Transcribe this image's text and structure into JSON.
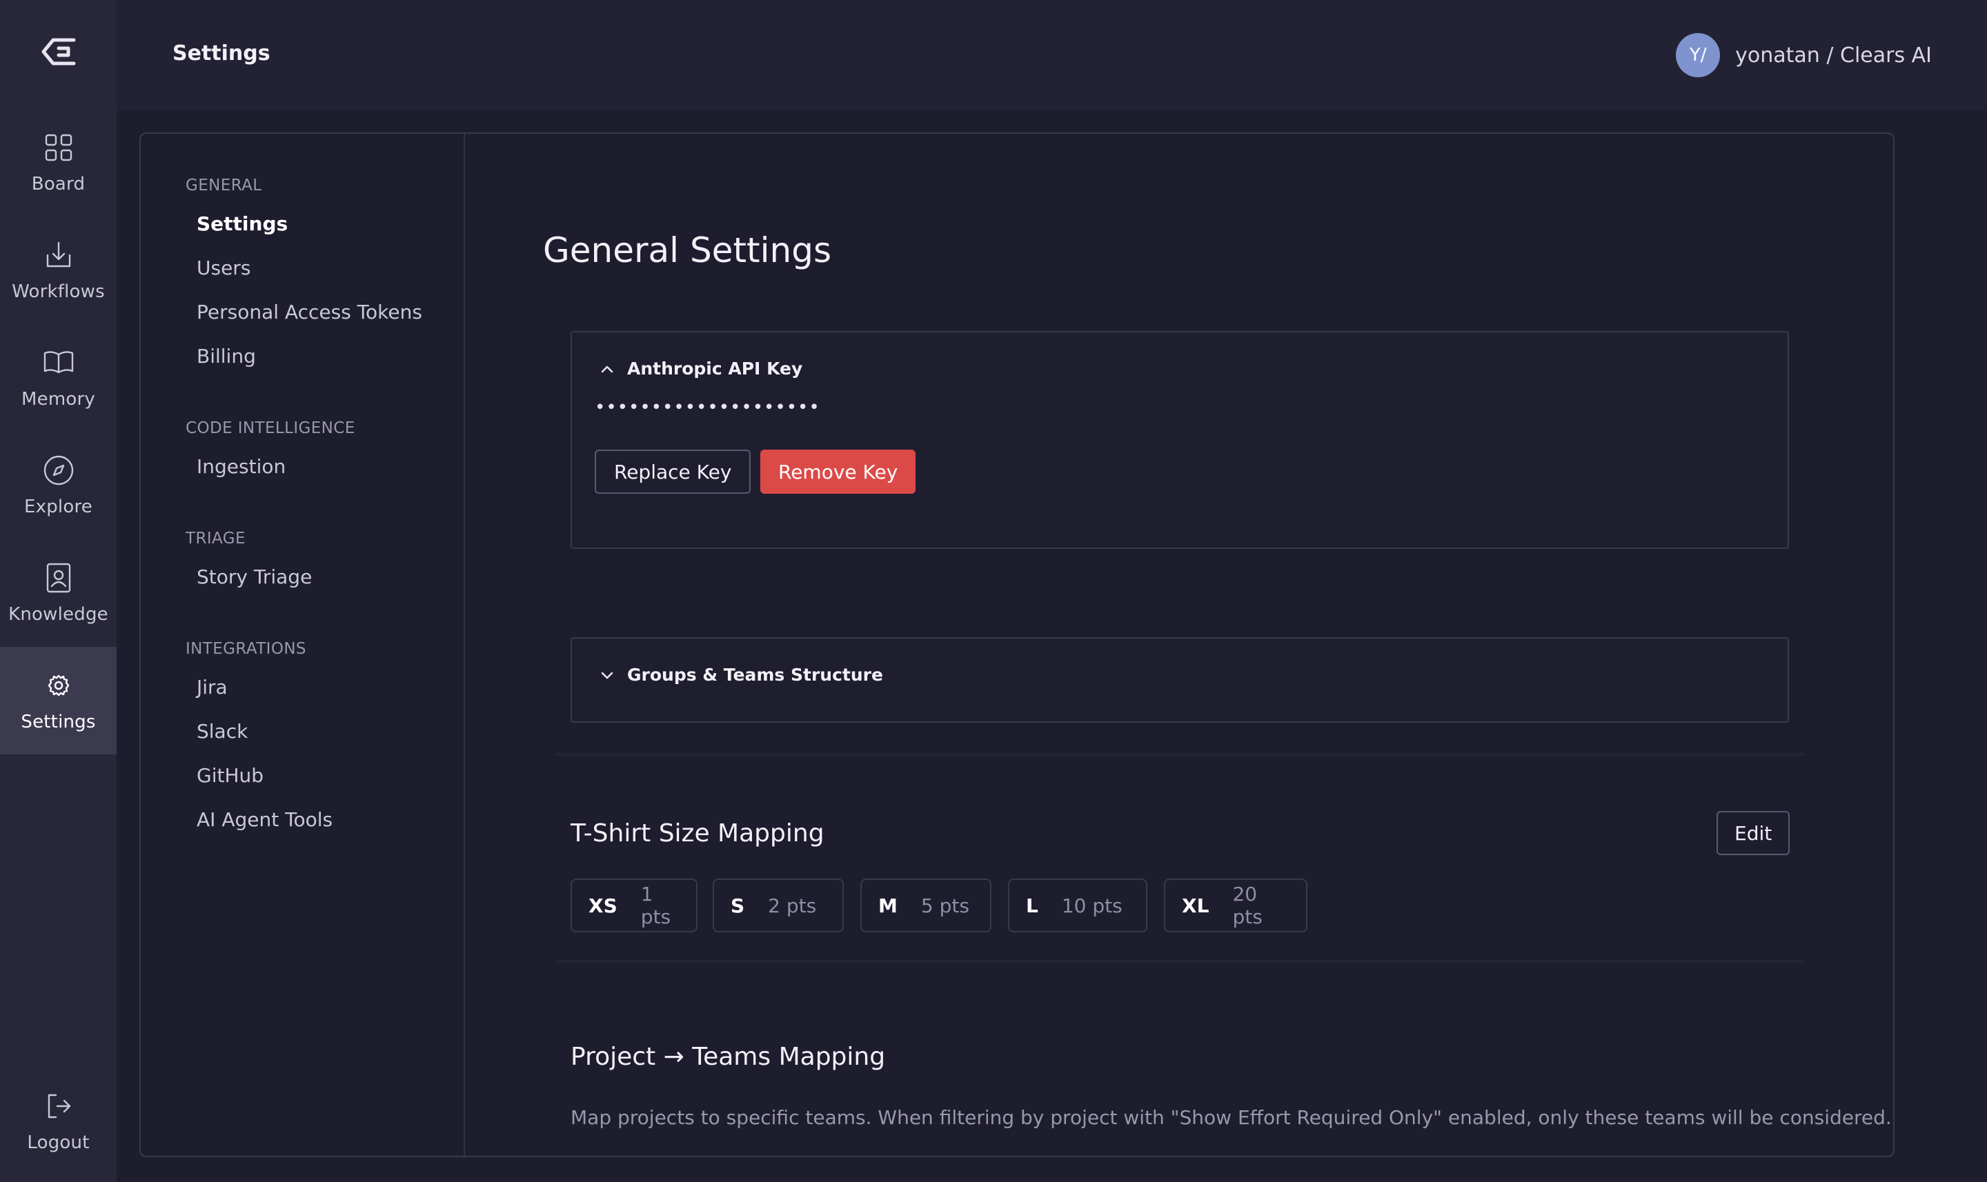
{
  "rail": {
    "items": [
      {
        "label": "Board",
        "icon": "grid-icon"
      },
      {
        "label": "Workflows",
        "icon": "workflow-icon"
      },
      {
        "label": "Memory",
        "icon": "book-icon"
      },
      {
        "label": "Explore",
        "icon": "compass-icon"
      },
      {
        "label": "Knowledge",
        "icon": "contact-book-icon"
      },
      {
        "label": "Settings",
        "icon": "gear-icon",
        "active": true
      }
    ],
    "logout": {
      "label": "Logout",
      "icon": "logout-icon"
    }
  },
  "header": {
    "title": "Settings",
    "avatar_initials": "Y/",
    "user_label": "yonatan / Clears AI"
  },
  "nav": {
    "sections": [
      {
        "title": "GENERAL",
        "items": [
          "Settings",
          "Users",
          "Personal Access Tokens",
          "Billing"
        ]
      },
      {
        "title": "CODE INTELLIGENCE",
        "items": [
          "Ingestion"
        ]
      },
      {
        "title": "TRIAGE",
        "items": [
          "Story Triage"
        ]
      },
      {
        "title": "INTEGRATIONS",
        "items": [
          "Jira",
          "Slack",
          "GitHub",
          "AI Agent Tools"
        ]
      }
    ],
    "active_item": "Settings"
  },
  "main": {
    "page_title": "General Settings",
    "api_key": {
      "title": "Anthropic API Key",
      "masked_value": "••••••••••••••••••••",
      "replace_label": "Replace Key",
      "remove_label": "Remove Key",
      "expanded": true
    },
    "groups": {
      "title": "Groups & Teams Structure",
      "expanded": false
    },
    "tshirt": {
      "title": "T-Shirt Size Mapping",
      "edit_label": "Edit",
      "sizes": [
        {
          "label": "XS",
          "pts": "1 pts"
        },
        {
          "label": "S",
          "pts": "2 pts"
        },
        {
          "label": "M",
          "pts": "5 pts"
        },
        {
          "label": "L",
          "pts": "10 pts"
        },
        {
          "label": "XL",
          "pts": "20 pts"
        }
      ]
    },
    "project_teams": {
      "title": "Project → Teams Mapping",
      "description": "Map projects to specific teams. When filtering by project with \"Show Effort Required Only\" enabled, only these teams will be considered."
    }
  },
  "colors": {
    "rail_bg": "#282739",
    "rail_active": "#3b3a4f",
    "page_bg": "#1e1d2e",
    "danger": "#dc4a48",
    "avatar": "#7f93cf"
  }
}
